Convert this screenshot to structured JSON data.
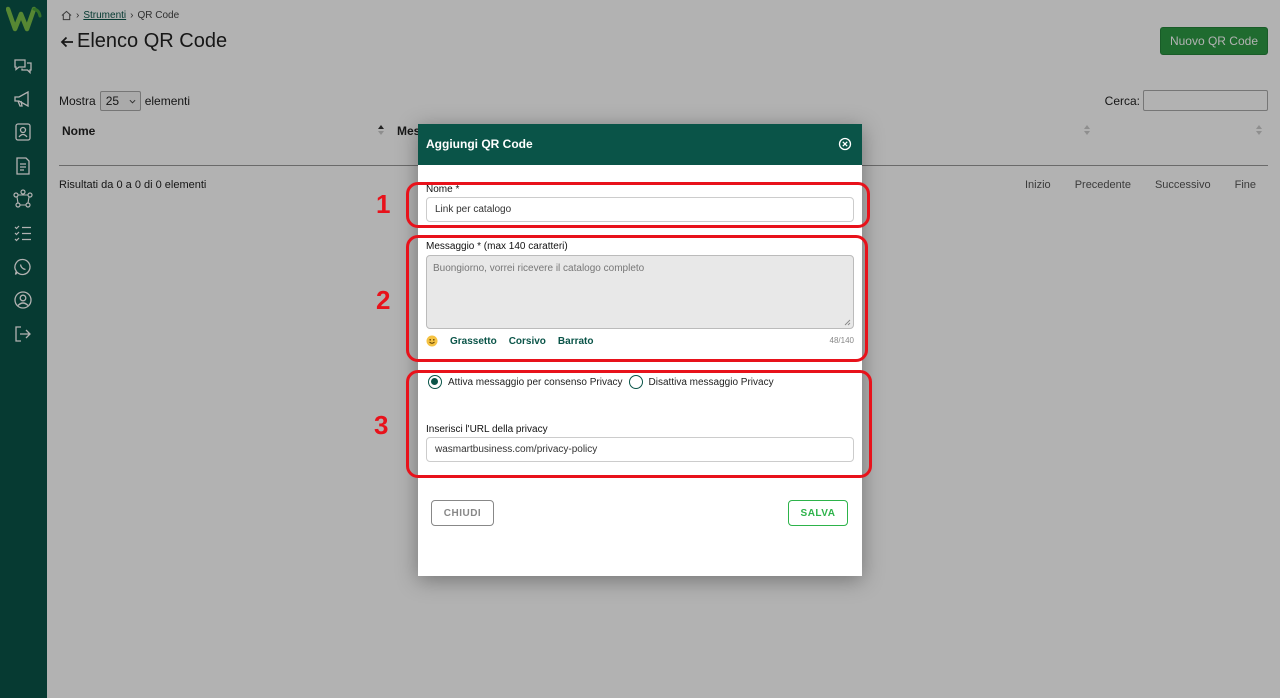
{
  "sidebar": {
    "icons": [
      "chat-icon",
      "megaphone-icon",
      "contacts-icon",
      "document-icon",
      "flow-icon",
      "checklist-icon",
      "whatsapp-icon",
      "user-icon",
      "logout-icon"
    ]
  },
  "breadcrumb": {
    "parent": "Strumenti",
    "current": "QR Code"
  },
  "page": {
    "title": "Elenco QR Code",
    "new_button": "Nuovo QR Code"
  },
  "table_controls": {
    "show_label": "Mostra",
    "show_value": "25",
    "elements_label": "elementi",
    "search_label": "Cerca:"
  },
  "table": {
    "columns": [
      "Nome",
      "Mes"
    ]
  },
  "footer": {
    "results": "Risultati da 0 a 0 di 0 elementi",
    "pager": [
      "Inizio",
      "Precedente",
      "Successivo",
      "Fine"
    ]
  },
  "modal": {
    "title": "Aggiungi QR Code",
    "name_label": "Nome *",
    "name_value": "Link per catalogo",
    "message_label": "Messaggio * (max 140 caratteri)",
    "message_value": "Buongiorno, vorrei ricevere il catalogo completo",
    "format_buttons": [
      "Grassetto",
      "Corsivo",
      "Barrato"
    ],
    "char_count": "48/140",
    "privacy_on": "Attiva messaggio per consenso Privacy",
    "privacy_off": "Disattiva messaggio Privacy",
    "privacy_url_label": "Inserisci l'URL della privacy",
    "privacy_url_value": "wasmartbusiness.com/privacy-policy",
    "close_button": "CHIUDI",
    "save_button": "SALVA"
  },
  "annotations": [
    "1",
    "2",
    "3"
  ],
  "colors": {
    "primary": "#0a5448",
    "accent_green": "#2d9a44",
    "annotation_red": "#e8121b"
  }
}
